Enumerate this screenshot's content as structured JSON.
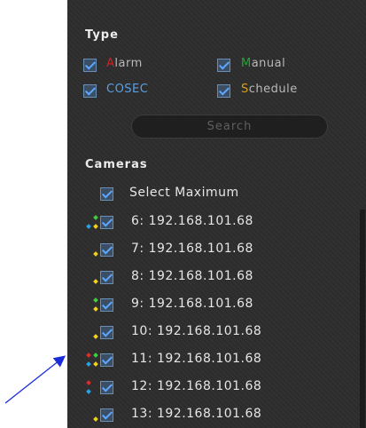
{
  "type_section": {
    "title": "Type",
    "options": [
      {
        "first": "A",
        "rest": "larm",
        "first_color": "#d42020"
      },
      {
        "first": "M",
        "rest": "anual",
        "first_color": "#27a33a"
      },
      {
        "first": "",
        "rest": "COSEC",
        "first_color": "#5aa0e6"
      },
      {
        "first": "S",
        "rest": "chedule",
        "first_color": "#d6a11a"
      }
    ]
  },
  "search": {
    "label": "Search"
  },
  "cameras_section": {
    "title": "Cameras",
    "select_max_label": "Select Maximum",
    "items": [
      {
        "label": "6: 192.168.101.68",
        "indicators": [
          "blue",
          "green",
          "yellow"
        ]
      },
      {
        "label": "7: 192.168.101.68",
        "indicators": [
          "yellow"
        ]
      },
      {
        "label": "8: 192.168.101.68",
        "indicators": [
          "yellow"
        ]
      },
      {
        "label": "9: 192.168.101.68",
        "indicators": [
          "green",
          "yellow"
        ]
      },
      {
        "label": "10: 192.168.101.68",
        "indicators": [
          "yellow"
        ]
      },
      {
        "label": "11: 192.168.101.68",
        "indicators": [
          "red",
          "blue",
          "green",
          "yellow"
        ]
      },
      {
        "label": "12: 192.168.101.68",
        "indicators": [
          "red",
          "blue"
        ]
      },
      {
        "label": "13: 192.168.101.68",
        "indicators": [
          "yellow"
        ]
      }
    ]
  },
  "colors": {
    "red": "#e02b2b",
    "blue": "#27a3e8",
    "green": "#3fce3f",
    "yellow": "#f3d21a",
    "arrow": "#1a2cd9"
  }
}
